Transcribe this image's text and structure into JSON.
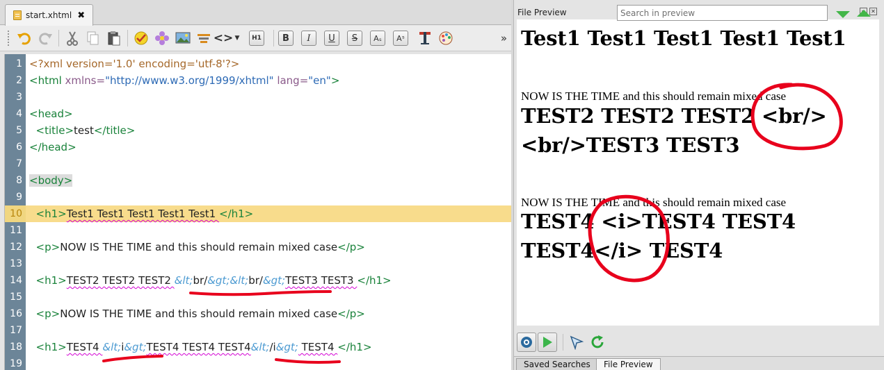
{
  "editor": {
    "tab_label": "start.xhtml",
    "tab_close": "✖",
    "lines": [
      {
        "n": "1"
      },
      {
        "n": "2"
      },
      {
        "n": "3"
      },
      {
        "n": "4"
      },
      {
        "n": "5"
      },
      {
        "n": "6"
      },
      {
        "n": "7"
      },
      {
        "n": "8"
      },
      {
        "n": "9"
      },
      {
        "n": "10"
      },
      {
        "n": "11"
      },
      {
        "n": "12"
      },
      {
        "n": "13"
      },
      {
        "n": "14"
      },
      {
        "n": "15"
      },
      {
        "n": "16"
      },
      {
        "n": "17"
      },
      {
        "n": "18"
      },
      {
        "n": "19"
      }
    ],
    "code": {
      "l1_pi": "<?xml version='1.0' encoding='utf-8'?>",
      "l2_open": "<html",
      "l2_attr1": " xmlns=",
      "l2_val1": "\"http://www.w3.org/1999/xhtml\"",
      "l2_attr2": " lang=",
      "l2_val2": "\"en\"",
      "l2_close": ">",
      "head_open": "<head>",
      "title_open": "<title>",
      "title_text": "test",
      "title_close": "</title>",
      "head_close": "</head>",
      "body_open": "<body>",
      "h1_open": "<h1>",
      "h1_close": "</h1>",
      "p_open": "<p>",
      "p_close": "</p>",
      "l10_text": "Test1 Test1 Test1 Test1 Test1 ",
      "l12_text": "NOW IS THE TIME and this should remain mixed case",
      "l14_a": "TEST2 TEST2 TEST2 ",
      "ent_lt": "&lt;",
      "ent_gt": "&gt;",
      "l14_br": "br/",
      "l14_tail": "TEST3 TEST3 ",
      "l16_text": "NOW IS THE TIME and this should remain mixed case",
      "l18_a": "TEST4 ",
      "l18_i": "i",
      "l18_mid": "TEST4 TEST4 TEST4",
      "l18_ci": "/i",
      "l18_tail": " TEST4 "
    }
  },
  "toolbar": {
    "bold": "B",
    "italic": "I",
    "underline": "U",
    "strike": "S",
    "sub": "Aₛ",
    "sup": "Aˢ",
    "heading": "H1",
    "code_tag": "<>",
    "overflow": "»"
  },
  "preview": {
    "title": "File Preview",
    "h1_a": "Test1 Test1 Test1 Test1 Test1",
    "p_a": "NOW IS THE TIME and this should remain mixed case",
    "h1_b": "TEST2 TEST2 TEST2 <br/><br/>TEST3 TEST3",
    "p_b": "NOW IS THE TIME and this should remain mixed case",
    "h1_c": "TEST4 <i>TEST4 TEST4 TEST4</i> TEST4",
    "search_placeholder": "Search in preview",
    "tab_saved": "Saved Searches",
    "tab_preview": "File Preview"
  },
  "colors": {
    "annotation_red": "#e8001c",
    "gutter": "#6c8598",
    "current_line": "#f8dc8c"
  }
}
